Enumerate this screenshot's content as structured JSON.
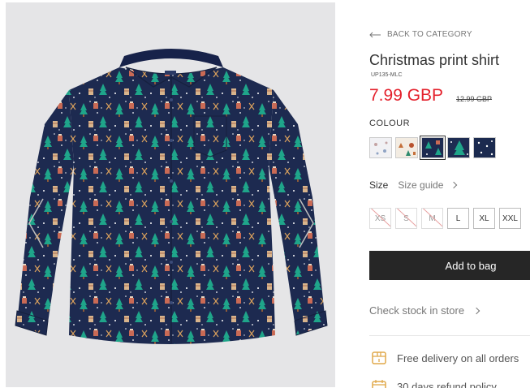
{
  "product": {
    "back_link": "BACK TO CATEGORY",
    "title": "Christmas print shirt",
    "sku": "UP135-MLC",
    "price": "7.99 GBP",
    "old_price": "12.99 GBP",
    "colour_label": "COLOUR",
    "size_label": "Size",
    "size_guide": "Size guide",
    "sizes": [
      {
        "label": "XS",
        "available": false
      },
      {
        "label": "S",
        "available": false
      },
      {
        "label": "M",
        "available": false
      },
      {
        "label": "L",
        "available": true
      },
      {
        "label": "XL",
        "available": true
      },
      {
        "label": "XXL",
        "available": true
      }
    ],
    "add_to_bag": "Add to bag",
    "check_stock": "Check stock in store",
    "perks": [
      "Free delivery on all orders",
      "30 days refund policy"
    ]
  },
  "colors": {
    "price": "#e4212c",
    "button": "#262626",
    "shirt_navy": "#1d2a50",
    "tree_green": "#1fa58a",
    "gallery_bg": "#e5e5e7"
  },
  "icons": [
    "back-arrow-icon",
    "chevron-left-icon",
    "chevron-right-icon",
    "delivery-box-icon",
    "calendar-icon"
  ]
}
